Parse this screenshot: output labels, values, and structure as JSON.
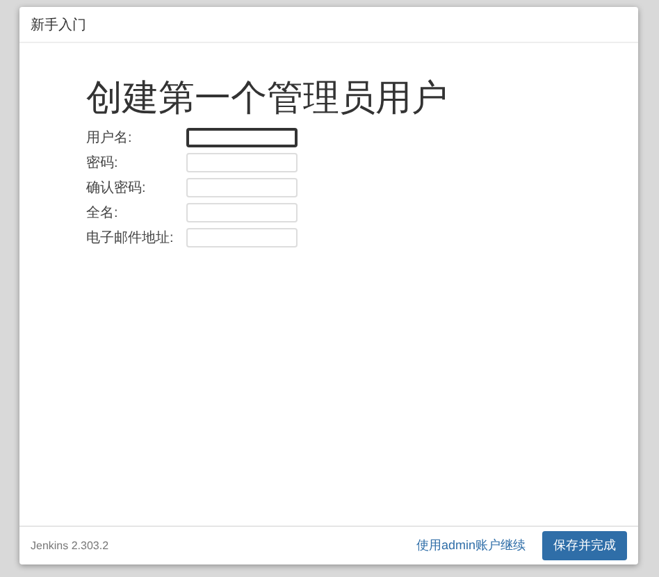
{
  "dialog": {
    "title": "新手入门"
  },
  "heading": "创建第一个管理员用户",
  "fields": [
    {
      "label": "用户名:",
      "focused": true
    },
    {
      "label": "密码:",
      "focused": false
    },
    {
      "label": "确认密码:",
      "focused": false
    },
    {
      "label": "全名:",
      "focused": false
    },
    {
      "label": "电子邮件地址:",
      "focused": false
    }
  ],
  "footer": {
    "version": "Jenkins 2.303.2",
    "link": "使用admin账户继续",
    "button": "保存并完成"
  }
}
